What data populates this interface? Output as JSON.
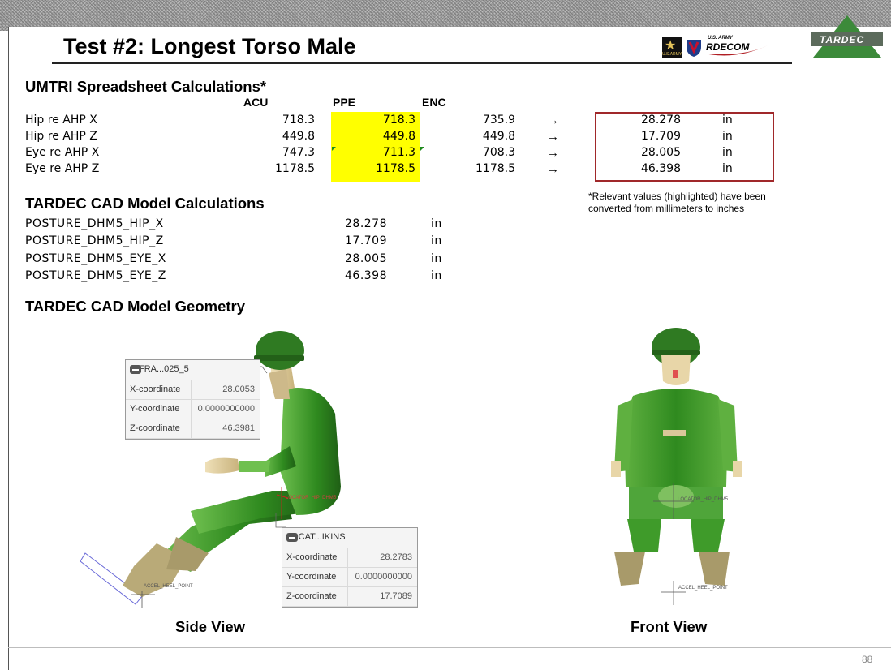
{
  "title": "Test #2: Longest Torso Male",
  "logos": {
    "army_label": "U.S.ARMY",
    "rdecom_small": "U.S. ARMY",
    "rdecom_main": "RDECOM",
    "tardec": "TARDEC"
  },
  "umtri": {
    "heading": "UMTRI Spreadsheet Calculations*",
    "columns": [
      "ACU",
      "PPE",
      "ENC"
    ],
    "rows": [
      {
        "label": "Hip re AHP X",
        "acu": "718.3",
        "ppe": "718.3",
        "enc": "735.9",
        "value": "28.278",
        "unit": "in"
      },
      {
        "label": "Hip re AHP Z",
        "acu": "449.8",
        "ppe": "449.8",
        "enc": "449.8",
        "value": "17.709",
        "unit": "in"
      },
      {
        "label": "Eye re AHP X",
        "acu": "747.3",
        "ppe": "711.3",
        "enc": "708.3",
        "value": "28.005",
        "unit": "in"
      },
      {
        "label": "Eye re AHP Z",
        "acu": "1178.5",
        "ppe": "1178.5",
        "enc": "1178.5",
        "value": "46.398",
        "unit": "in"
      }
    ],
    "arrow": "→"
  },
  "note": "*Relevant values (highlighted) have been converted from millimeters to inches",
  "cad_calc": {
    "heading": "TARDEC CAD Model Calculations",
    "rows": [
      {
        "name": "POSTURE_DHM5_HIP_X",
        "value": "28.278",
        "unit": "in"
      },
      {
        "name": "POSTURE_DHM5_HIP_Z",
        "value": "17.709",
        "unit": "in"
      },
      {
        "name": "POSTURE_DHM5_EYE_X",
        "value": "28.005",
        "unit": "in"
      },
      {
        "name": "POSTURE_DHM5_EYE_Z",
        "value": "46.398",
        "unit": "in"
      }
    ]
  },
  "cad_geom": {
    "heading": "TARDEC CAD Model Geometry"
  },
  "info_eye": {
    "title": "INFRA...025_5",
    "rows": [
      {
        "k": "X-coordinate",
        "v": "28.0053"
      },
      {
        "k": "Y-coordinate",
        "v": "0.0000000000"
      },
      {
        "k": "Z-coordinate",
        "v": "46.3981"
      }
    ]
  },
  "info_hip": {
    "title": "LOCAT...IKINS",
    "rows": [
      {
        "k": "X-coordinate",
        "v": "28.2783"
      },
      {
        "k": "Y-coordinate",
        "v": "0.0000000000"
      },
      {
        "k": "Z-coordinate",
        "v": "17.7089"
      }
    ]
  },
  "labels": {
    "side_hip": "LOCATOR_HIP_DHM5",
    "side_heel": "ACCEL_HEEL_POINT",
    "front_hip": "LOCATOR_HIP_DHM5",
    "front_heel": "ACCEL_HEEL_POINT"
  },
  "captions": {
    "side": "Side View",
    "front": "Front View"
  },
  "page_number": "88",
  "colors": {
    "highlight": "#ffff00",
    "box_border": "#a0282a",
    "uniform": "#3f9b2a",
    "helmet": "#2f7a22",
    "skin": "#d9c79a",
    "boot": "#a89a6a"
  }
}
